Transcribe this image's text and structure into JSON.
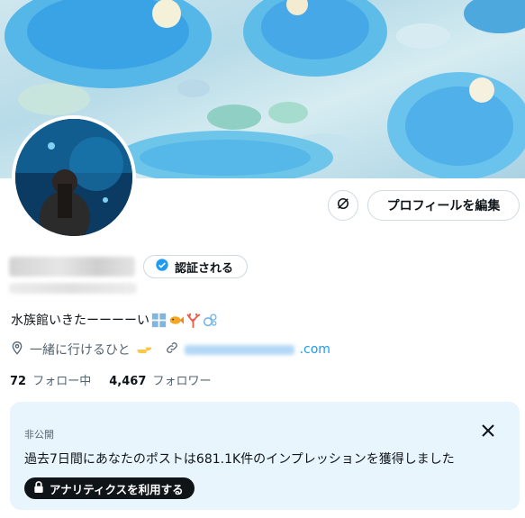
{
  "banner": {
    "icon": "banner-photo-sea-glass-dishes"
  },
  "avatar": {
    "icon": "avatar-aquarium-photo"
  },
  "actions": {
    "refresh_icon": "refresh-icon",
    "edit_profile_label": "プロフィールを編集"
  },
  "profile": {
    "verify_label": "認証される",
    "verify_icon": "verified-badge-icon",
    "bio_text": "水族館いきたーーーーい",
    "bio_emojis": [
      "window-emoji",
      "fish-emoji",
      "coral-emoji",
      "bubbles-emoji"
    ],
    "location": "一緒に行けるひと",
    "location_emoji": "pointing-hand-emoji",
    "link_suffix": ".com"
  },
  "stats": {
    "following_count": "72",
    "following_label": "フォロー中",
    "followers_count": "4,467",
    "followers_label": "フォロワー"
  },
  "analytics_card": {
    "private_label": "非公開",
    "message": "過去7日間にあなたのポストは681.1K件のインプレッションを獲得しました",
    "button_label": "アナリティクスを利用する",
    "colors": {
      "background": "#e8f5fd",
      "button": "#0f1419"
    }
  },
  "colors": {
    "accent": "#1d9bf0",
    "secondary_text": "#536471",
    "border": "#cfd9de"
  }
}
